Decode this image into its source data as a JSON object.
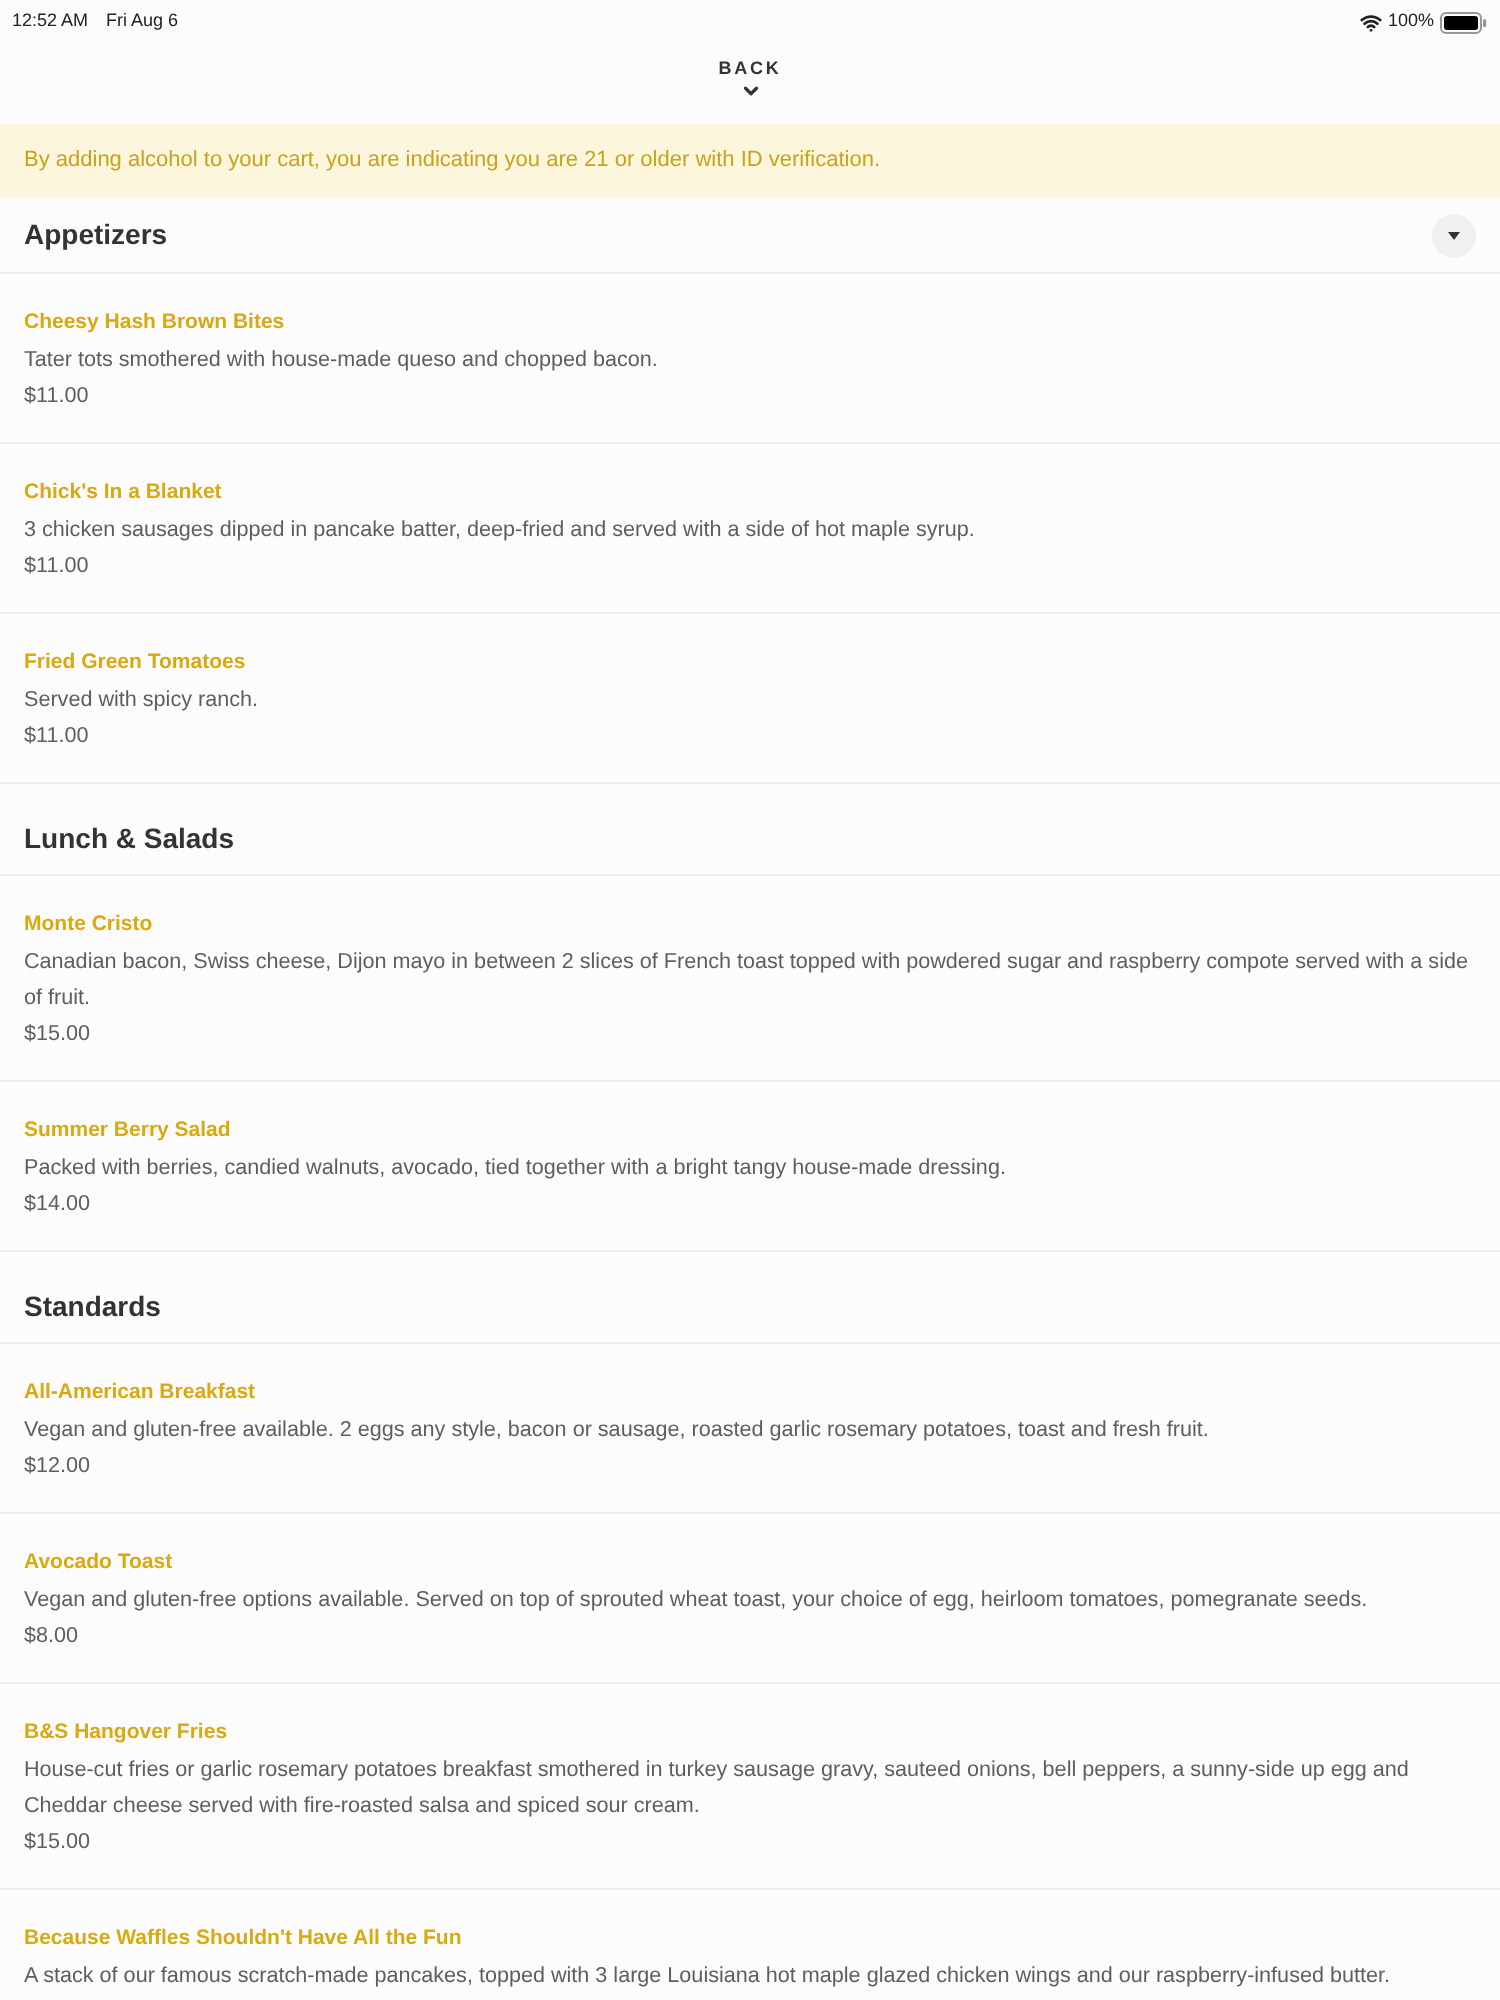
{
  "status_bar": {
    "time": "12:52 AM",
    "date": "Fri Aug 6",
    "battery": "100%"
  },
  "back_button": {
    "label": "BACK"
  },
  "notice": "By adding alcohol to your cart, you are indicating you are 21 or older with ID verification.",
  "sections": [
    {
      "title": "Appetizers",
      "toggle": true,
      "items": [
        {
          "name": "Cheesy Hash Brown Bites",
          "description": "Tater tots smothered with house-made queso and chopped bacon.",
          "price": "$11.00"
        },
        {
          "name": "Chick's In a Blanket",
          "description": "3 chicken sausages dipped in pancake batter, deep-fried and served with a side of hot maple syrup.",
          "price": "$11.00"
        },
        {
          "name": "Fried Green Tomatoes",
          "description": "Served with spicy ranch.",
          "price": "$11.00"
        }
      ]
    },
    {
      "title": "Lunch & Salads",
      "toggle": false,
      "items": [
        {
          "name": "Monte Cristo",
          "description": "Canadian bacon, Swiss cheese, Dijon mayo in between 2 slices of French toast topped with powdered sugar and raspberry compote served with a side of fruit.",
          "price": "$15.00"
        },
        {
          "name": "Summer Berry Salad",
          "description": "Packed with berries, candied walnuts, avocado, tied together with a bright tangy house-made dressing.",
          "price": "$14.00"
        }
      ]
    },
    {
      "title": "Standards",
      "toggle": false,
      "items": [
        {
          "name": "All-American Breakfast",
          "description": "Vegan and gluten-free available. 2 eggs any style, bacon or sausage, roasted garlic rosemary potatoes, toast and fresh fruit.",
          "price": "$12.00"
        },
        {
          "name": "Avocado Toast",
          "description": "Vegan and gluten-free options available. Served on top of sprouted wheat toast, your choice of egg, heirloom tomatoes, pomegranate seeds.",
          "price": "$8.00"
        },
        {
          "name": "B&S Hangover Fries",
          "description": "House-cut fries or garlic rosemary potatoes breakfast smothered in turkey sausage gravy, sauteed onions, bell peppers, a sunny-side up egg and Cheddar cheese served with fire-roasted salsa and spiced sour cream.",
          "price": "$15.00"
        },
        {
          "name": "Because Waffles Shouldn't Have All the Fun",
          "description": "A stack of our famous scratch-made pancakes, topped with 3 large Louisiana hot maple glazed chicken wings and our raspberry-infused butter."
        }
      ]
    }
  ]
}
